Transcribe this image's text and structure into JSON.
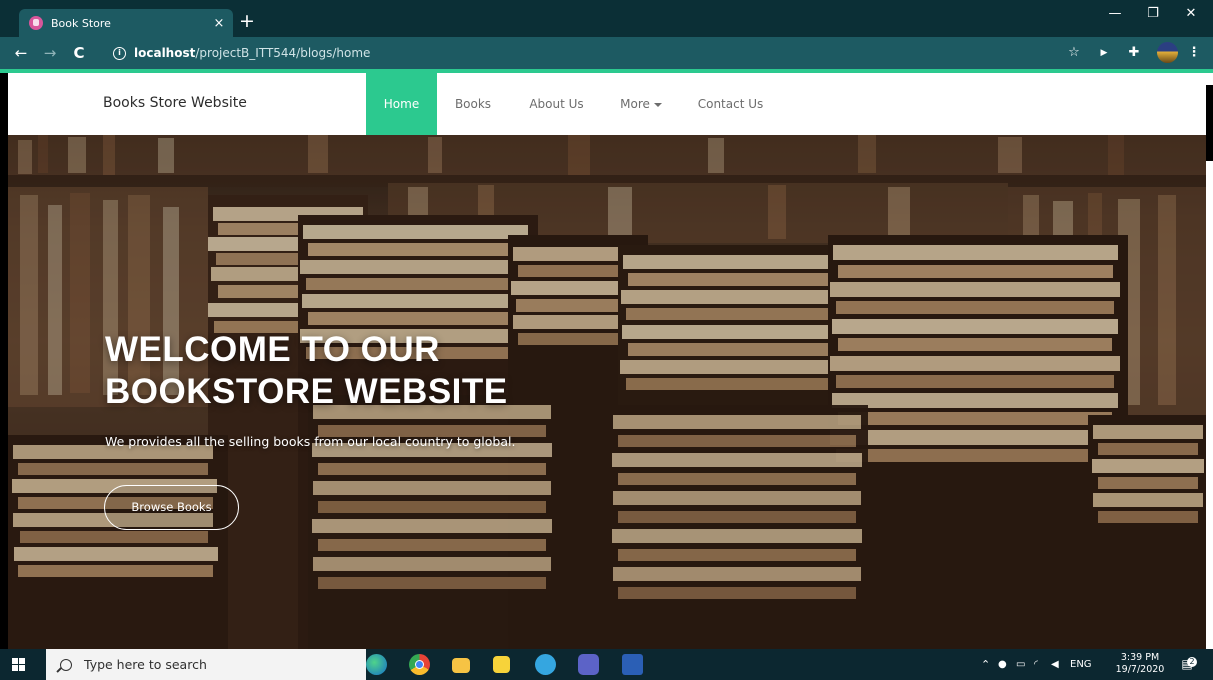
{
  "browser": {
    "tab_title": "Book Store",
    "tab_close": "×",
    "new_tab": "+",
    "url_host": "localhost",
    "url_path": "/projectB_ITT544/blogs/home",
    "controls": {
      "minimize": "—",
      "maximize": "❐",
      "close": "✕"
    }
  },
  "site": {
    "brand": "Books Store Website",
    "nav": [
      {
        "label": "Home",
        "active": true
      },
      {
        "label": "Books"
      },
      {
        "label": "About Us"
      },
      {
        "label": "More"
      },
      {
        "label": "Contact Us"
      }
    ]
  },
  "hero": {
    "title_line1": "WELCOME TO OUR",
    "title_line2": "BOOKSTORE WEBSITE",
    "subtitle": "We provides all the selling books from our local country to global.",
    "button": "Browse Books"
  },
  "taskbar": {
    "search_placeholder": "Type here to search",
    "language": "ENG",
    "time": "3:39 PM",
    "date": "19/7/2020",
    "notifications": "2"
  },
  "colors": {
    "accent": "#2cc98f",
    "chrome_dark": "#0b2f36",
    "chrome_bar": "#1d5a62",
    "taskbar": "#0c2730"
  }
}
